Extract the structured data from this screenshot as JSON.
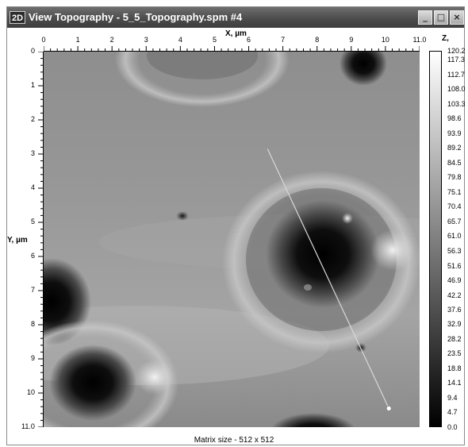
{
  "window": {
    "icon_text": "2D",
    "title": "View Topography - 5_5_Topography.spm #4",
    "minimize_symbol": "_",
    "maximize_symbol": "□",
    "close_symbol": "×"
  },
  "axes": {
    "x_label": "X, µm",
    "y_label": "Y, µm",
    "z_label": "Z,",
    "x_ticks": [
      "0",
      "1",
      "2",
      "3",
      "4",
      "5",
      "6",
      "7",
      "8",
      "9",
      "10",
      "11.0"
    ],
    "y_ticks": [
      "0",
      "1",
      "2",
      "3",
      "4",
      "5",
      "6",
      "7",
      "8",
      "9",
      "10",
      "11.0"
    ],
    "x_range": [
      0,
      11.0
    ],
    "y_range": [
      0,
      11.0
    ]
  },
  "colorbar": {
    "range": [
      0,
      120.2
    ],
    "ticks": [
      "120.2",
      "117.3",
      "112.7",
      "108.0",
      "103.3",
      "98.6",
      "93.9",
      "89.2",
      "84.5",
      "79.8",
      "75.1",
      "70.4",
      "65.7",
      "61.0",
      "56.3",
      "51.6",
      "46.9",
      "42.2",
      "37.6",
      "32.9",
      "28.2",
      "23.5",
      "18.8",
      "14.1",
      "9.4",
      "4.7",
      "0.0"
    ]
  },
  "footer": {
    "matrix_size": "Matrix size - 512 x 512"
  },
  "profile_line": {
    "start": [
      6.55,
      2.85
    ],
    "end": [
      10.1,
      10.45
    ]
  }
}
